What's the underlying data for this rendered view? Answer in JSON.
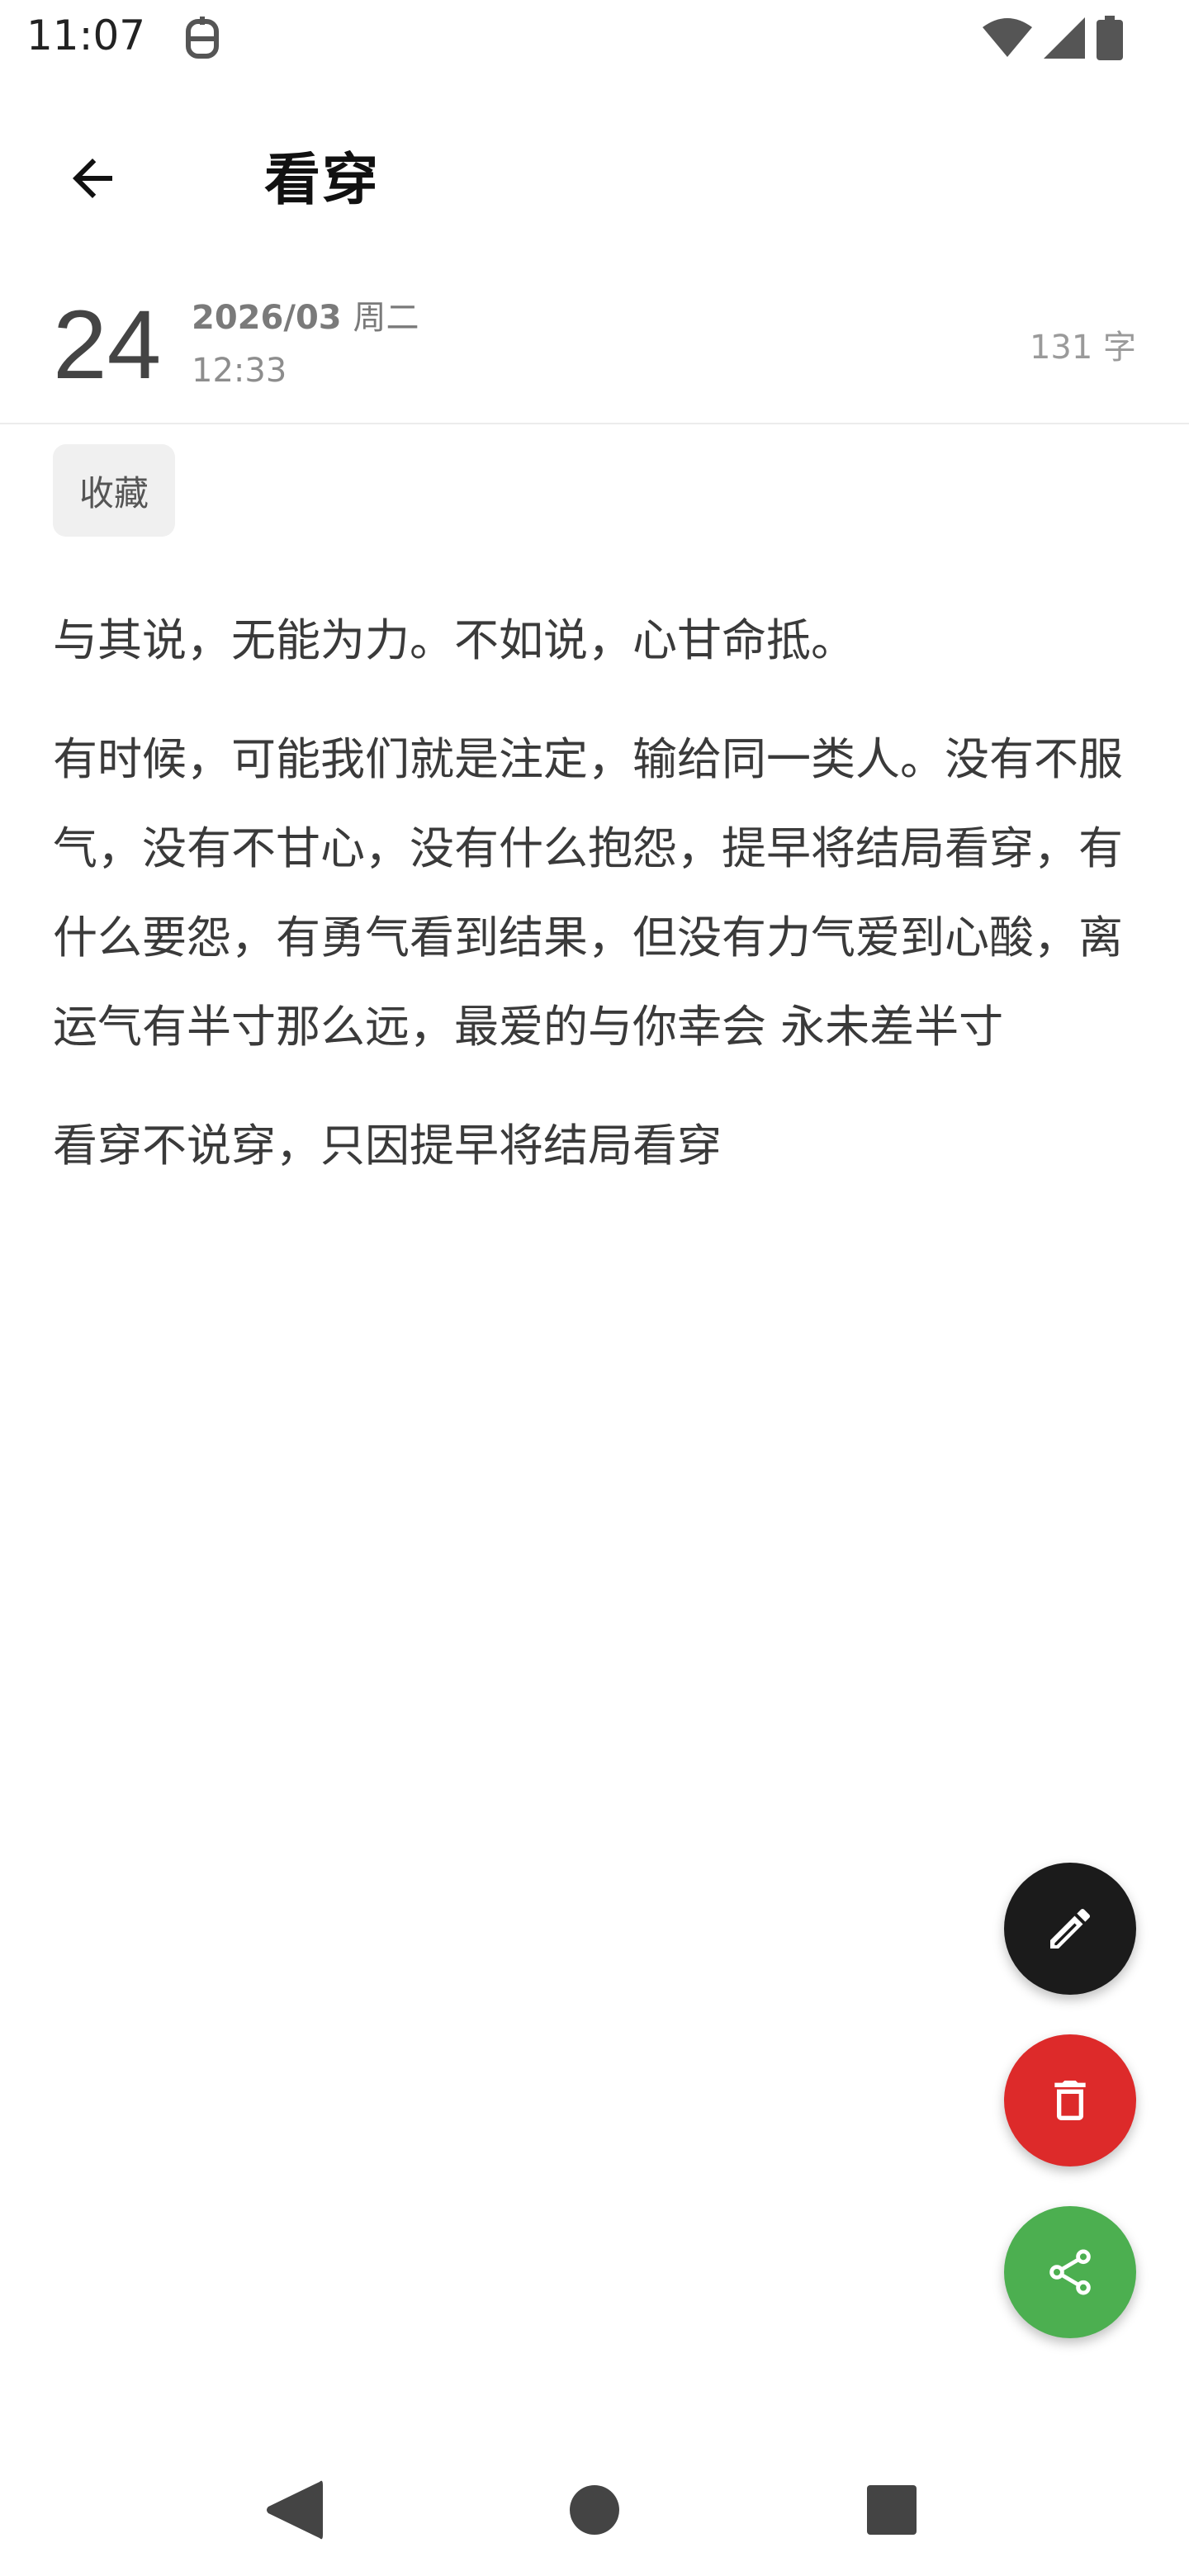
{
  "status_bar": {
    "time": "11:07",
    "icons": [
      "notification-icon",
      "wifi-icon",
      "signal-icon",
      "battery-icon"
    ]
  },
  "app_bar": {
    "title": "看穿",
    "back_icon": "arrow-left-icon"
  },
  "entry": {
    "day": "24",
    "year_month": "2026/03",
    "weekday": "周二",
    "time": "12:33",
    "word_count": "131 字"
  },
  "tag": "收藏",
  "paragraphs": [
    "与其说，无能为力。不如说，心甘命抵。",
    "有时候，可能我们就是注定，输给同一类人。没有不服气，没有不甘心，没有什么抱怨，提早将结局看穿，有什么要怨，有勇气看到结果，但没有力气爱到心酸，离运气有半寸那么远，最爱的与你幸会 永未差半寸",
    "看穿不说穿，只因提早将结局看穿"
  ],
  "fabs": [
    {
      "name": "edit",
      "icon": "pencil-icon",
      "color": "#1b1b1b"
    },
    {
      "name": "delete",
      "icon": "trash-icon",
      "color": "#dd2a2a"
    },
    {
      "name": "share",
      "icon": "share-icon",
      "color": "#4caf50"
    }
  ],
  "nav_bar": {
    "icons": [
      "back-triangle-icon",
      "home-circle-icon",
      "recents-square-icon"
    ]
  }
}
